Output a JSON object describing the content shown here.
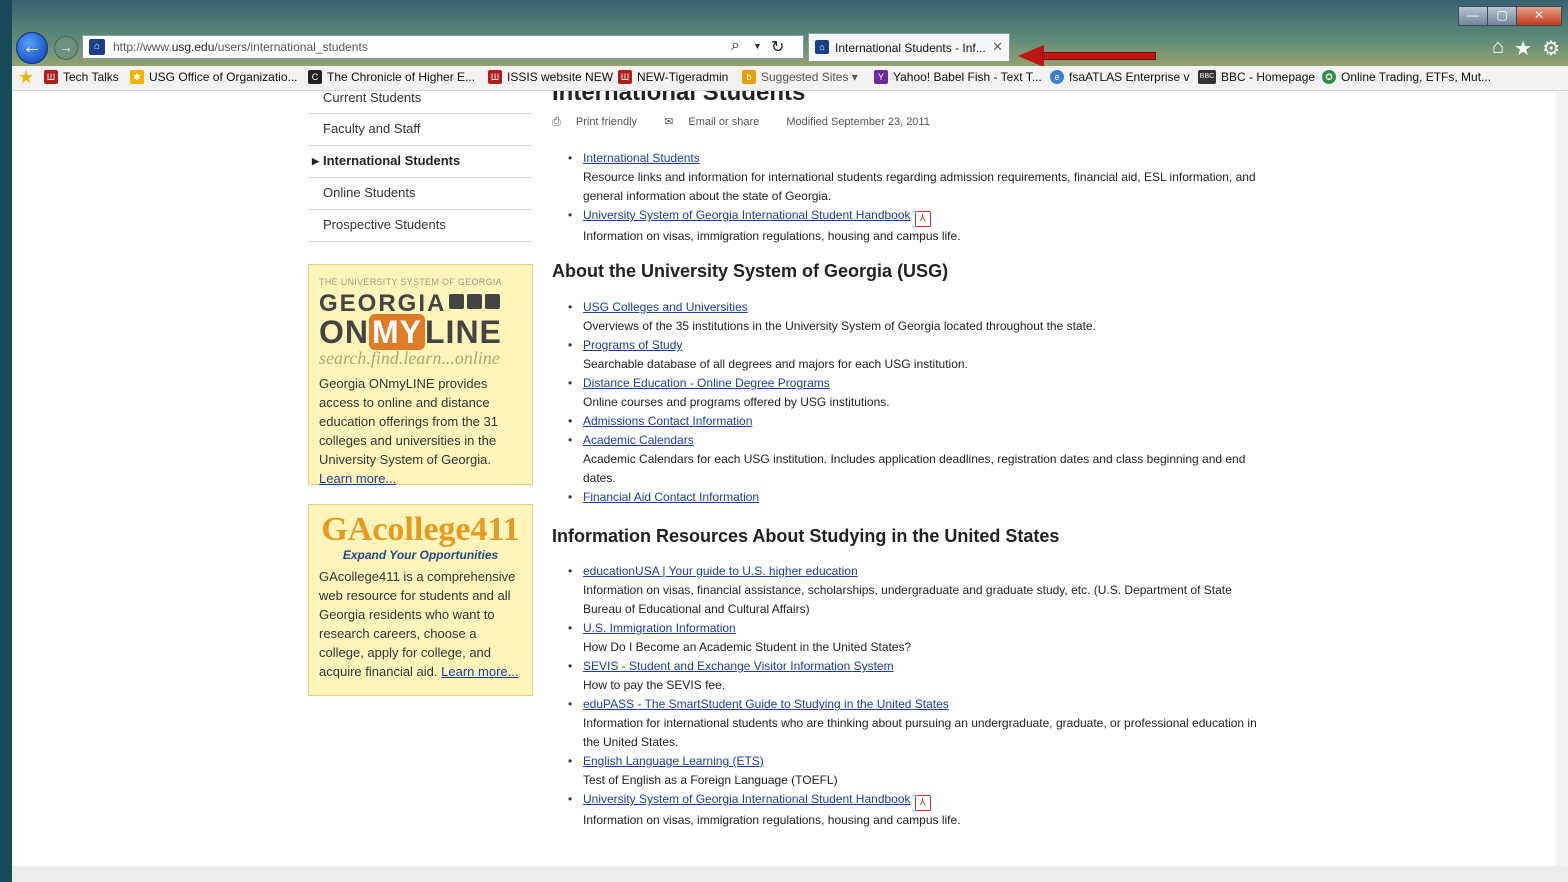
{
  "browser": {
    "url_prefix": "http://www.",
    "url_domain": "usg.edu",
    "url_path": "/users/international_students",
    "tab_title": "International Students - Inf...",
    "window_controls": [
      "—",
      "▢",
      "✕"
    ],
    "favorites": [
      {
        "label": "Tech Talks",
        "color": "#b01e1e"
      },
      {
        "label": "USG Office of Organizatio...",
        "color": "#f2b400"
      },
      {
        "label": "The Chronicle of Higher E...",
        "color": "#222222"
      },
      {
        "label": "ISSIS website NEW",
        "color": "#b01e1e"
      },
      {
        "label": "NEW-Tigeradmin",
        "color": "#b01e1e"
      },
      {
        "label": "Suggested Sites ▾",
        "color": "#e8a100"
      },
      {
        "label": "Yahoo! Babel Fish - Text T...",
        "color": "#6a2a9a"
      },
      {
        "label": "fsaATLAS Enterprise v",
        "color": "#3a7fd0"
      },
      {
        "label": "BBC - Homepage",
        "color": "#333333"
      },
      {
        "label": "Online Trading, ETFs, Mut...",
        "color": "#2f8d4a"
      }
    ]
  },
  "sidebar": {
    "items": [
      "Current Students",
      "Faculty and Staff",
      "International Students",
      "Online Students",
      "Prospective Students"
    ],
    "promo1": {
      "small": "THE UNIVERSITY SYSTEM OF GEORGIA",
      "top": "GEORGIA",
      "on": "ON",
      "my": "MY",
      "line": "LINE",
      "tagline": "search.find.learn...online",
      "text": "Georgia ONmyLINE provides access to online and distance education offerings from the 31 colleges and universities in the University System of Georgia.",
      "link": "Learn more..."
    },
    "promo2": {
      "title": "GAcollege411",
      "sub": "Expand Your Opportunities",
      "text": "GAcollege411 is a comprehensive web resource for students and all Georgia residents who want to research careers, choose a college, apply for college, and acquire financial aid.",
      "link": "Learn more..."
    }
  },
  "main": {
    "title": "International Students",
    "meta": {
      "print": "Print friendly",
      "email": "Email or share",
      "modified": "Modified September 23, 2011"
    },
    "sec0": [
      {
        "link": "International Students",
        "desc": "Resource links and information for international students regarding admission requirements, financial aid, ESL information, and general information about the state of Georgia."
      },
      {
        "link": "University System of Georgia International Student Handbook",
        "desc": "Information on visas, immigration regulations, housing and campus life."
      }
    ],
    "sec1_title": "About the University System of Georgia (USG)",
    "sec1": [
      {
        "link": "USG Colleges and Universities",
        "desc": "Overviews of the 35 institutions in the University System of Georgia located throughout the state."
      },
      {
        "link": "Programs of Study",
        "desc": "Searchable database of all degrees and majors for each USG institution."
      },
      {
        "link": "Distance Education - Online Degree Programs",
        "desc": "Online courses and programs offered by USG institutions."
      },
      {
        "link": "Admissions Contact Information",
        "desc": ""
      },
      {
        "link": "Academic Calendars",
        "desc": "Academic Calendars for each USG institution. Includes application deadlines, registration dates and class beginning and end dates."
      },
      {
        "link": "Financial Aid Contact Information",
        "desc": ""
      }
    ],
    "sec2_title": "Information Resources About Studying in the United States",
    "sec2": [
      {
        "link": "educationUSA | Your guide to U.S. higher education",
        "desc": "Information on visas, financial assistance, scholarships, undergraduate and graduate study, etc. (U.S. Department of State Bureau of Educational and Cultural Affairs)"
      },
      {
        "link": "U.S. Immigration Information",
        "desc": "How Do I Become an Academic Student in the United States?"
      },
      {
        "link": "SEVIS - Student and Exchange Visitor Information System",
        "desc": "How to pay the SEVIS fee."
      },
      {
        "link": "eduPASS - The SmartStudent Guide to Studying in the United States",
        "desc": "Information for international students who are thinking about pursuing an undergraduate, graduate, or professional education in the United States."
      },
      {
        "link": "English Language Learning (ETS)",
        "desc": "Test of English as a Foreign Language (TOEFL)"
      },
      {
        "link": "University System of Georgia International Student Handbook",
        "desc": "Information on visas, immigration regulations, housing and campus life."
      }
    ]
  }
}
